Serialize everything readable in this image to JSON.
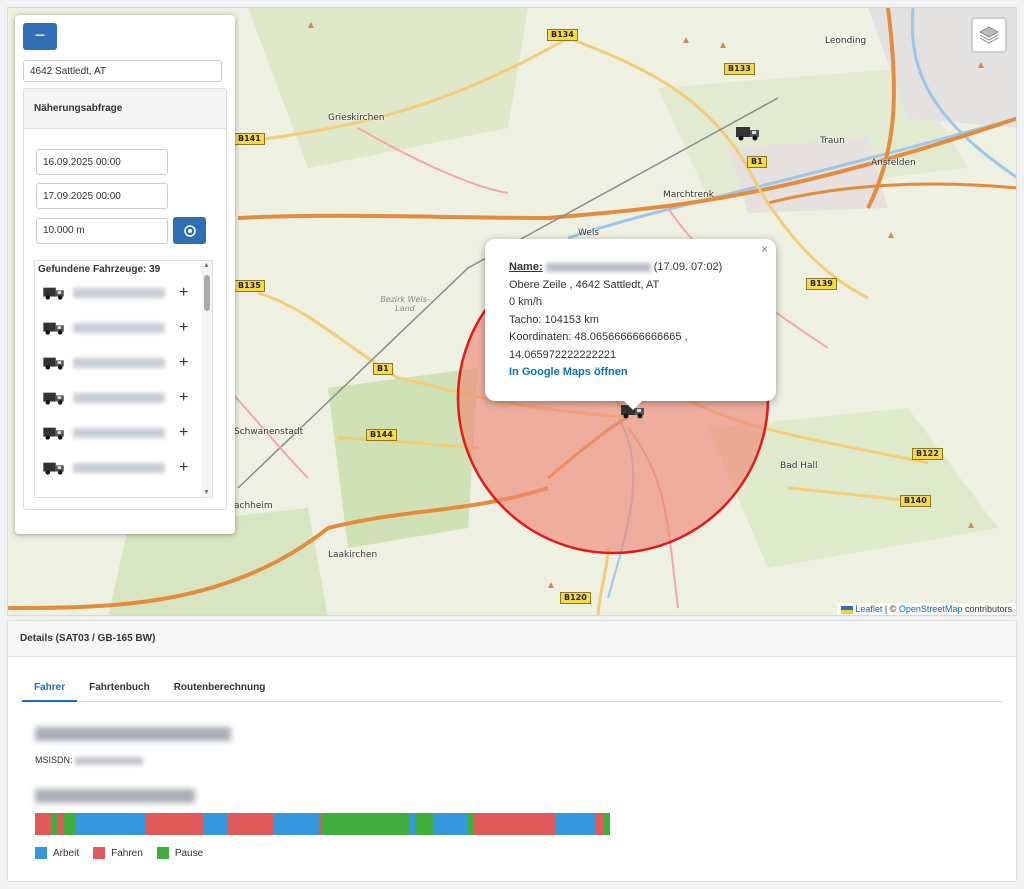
{
  "colors": {
    "accent": "#2f6db5",
    "circle_stroke": "#e11a1a",
    "circle_fill": "#f08a78",
    "arbeit": "#3598dc",
    "fahren": "#e05a5a",
    "pause": "#3fae3f"
  },
  "panel": {
    "collapse_label": "−",
    "address": "4642 Sattledt, AT",
    "section_title": "Näherungsabfrage",
    "date_from": "16.09.2025 00:00",
    "date_to": "17.09.2025 00:00",
    "radius": "10.000 m",
    "locate_icon": "crosshair-icon",
    "found_label": "Gefundene Fahrzeuge: 39",
    "vehicles": [
      {
        "icon": "truck-icon",
        "add": "+"
      },
      {
        "icon": "truck-icon",
        "add": "+"
      },
      {
        "icon": "truck-icon",
        "add": "+"
      },
      {
        "icon": "truck-icon",
        "add": "+"
      },
      {
        "icon": "truck-icon",
        "add": "+"
      },
      {
        "icon": "truck-icon",
        "add": "+"
      }
    ]
  },
  "map": {
    "layers_icon": "layers-icon",
    "towns": [
      "Leonding",
      "Grieskirchen",
      "Traun",
      "Ansfelden",
      "Marchtrenk",
      "Wels",
      "Schwanenstadt",
      "Bad Hall",
      "Laakirchen",
      "achheim"
    ],
    "region": "Bezirk Wels-Land",
    "shields": [
      "B134",
      "B133",
      "B141",
      "B1",
      "B135",
      "B1",
      "B144",
      "B139",
      "B122",
      "B140",
      "B120"
    ],
    "attribution_leaflet": "Leaflet",
    "attribution_sep": "| ©",
    "attribution_osm": "OpenStreetMap",
    "attribution_rest": "contributors"
  },
  "popup": {
    "close": "×",
    "name_label": "Name:",
    "time": "(17.09. 07:02)",
    "address": "Obere Zeile , 4642 Sattledt, AT",
    "speed": "0 km/h",
    "tacho": "Tacho: 104153 km",
    "coords_line1": "Koordinaten: 48.065666666666665 ,",
    "coords_line2": "14.065972222222221",
    "link": "In Google Maps öffnen"
  },
  "details": {
    "header": "Details (SAT03 / GB-165 BW)",
    "tabs": [
      "Fahrer",
      "Fahrtenbuch",
      "Routenberechnung"
    ],
    "msisdn_label": "MSISDN:",
    "timeline": [
      {
        "type": "fahren",
        "w": 3
      },
      {
        "type": "pause",
        "w": 1
      },
      {
        "type": "fahren",
        "w": 1
      },
      {
        "type": "pause",
        "w": 2
      },
      {
        "type": "arbeit",
        "w": 12
      },
      {
        "type": "fahren",
        "w": 10
      },
      {
        "type": "arbeit",
        "w": 4
      },
      {
        "type": "fahren",
        "w": 8
      },
      {
        "type": "arbeit",
        "w": 8
      },
      {
        "type": "fahren",
        "w": 0.5
      },
      {
        "type": "pause",
        "w": 15
      },
      {
        "type": "arbeit",
        "w": 1
      },
      {
        "type": "pause",
        "w": 3
      },
      {
        "type": "arbeit",
        "w": 6
      },
      {
        "type": "pause",
        "w": 1
      },
      {
        "type": "fahren",
        "w": 14
      },
      {
        "type": "arbeit",
        "w": 7
      },
      {
        "type": "fahren",
        "w": 1.5
      },
      {
        "type": "pause",
        "w": 1
      }
    ],
    "legend": [
      {
        "type": "arbeit",
        "label": "Arbeit"
      },
      {
        "type": "fahren",
        "label": "Fahren"
      },
      {
        "type": "pause",
        "label": "Pause"
      }
    ]
  }
}
